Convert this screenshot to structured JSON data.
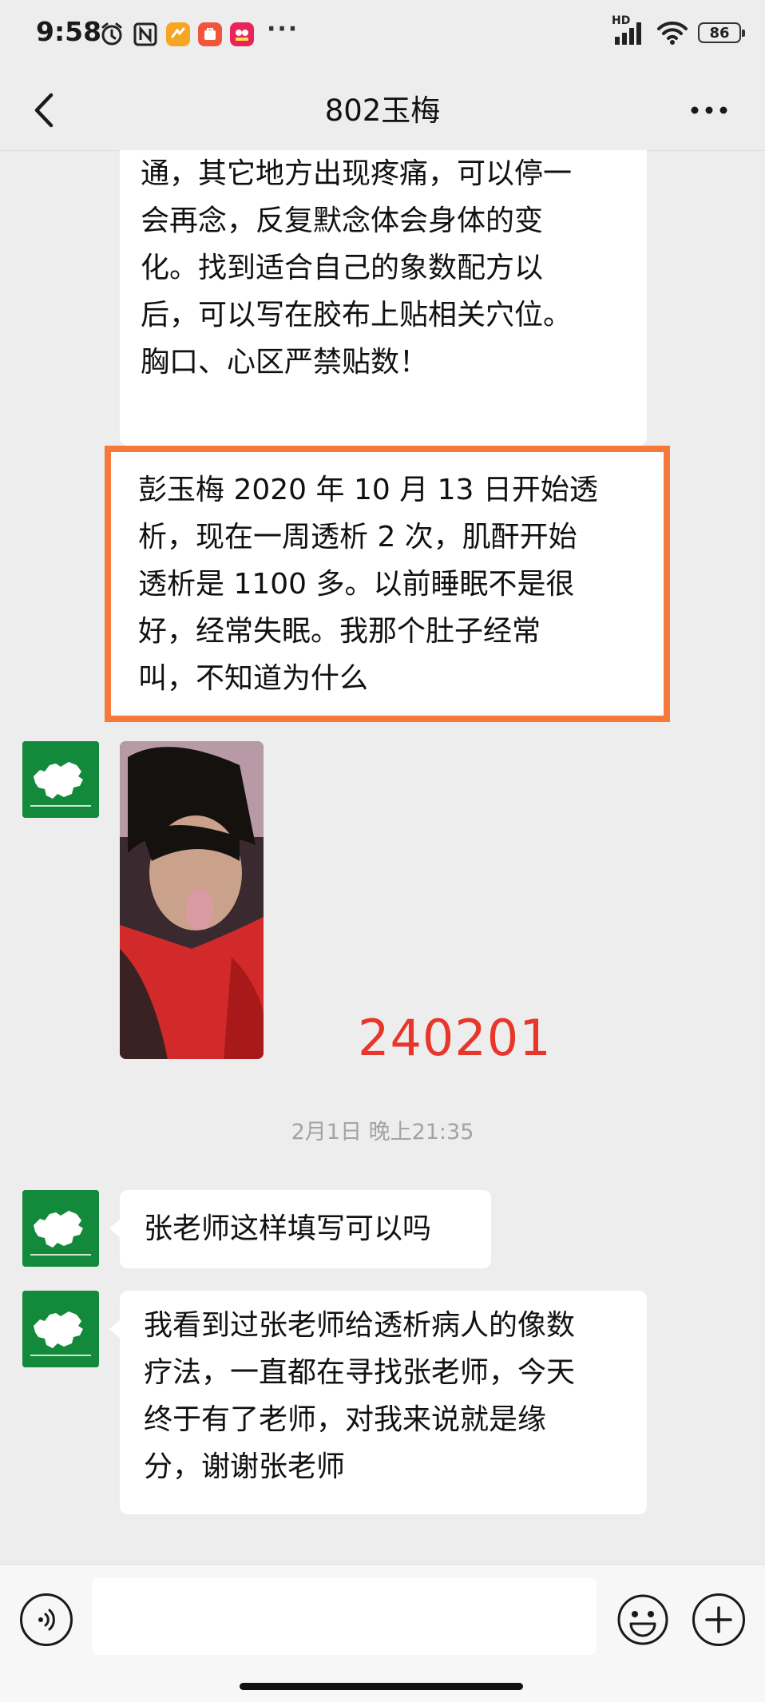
{
  "status": {
    "time": "9:58",
    "network_badge": "HD",
    "battery": "86"
  },
  "header": {
    "title": "802玉梅"
  },
  "messages": {
    "top_lines": [
      "通，其它地方出现疼痛，可以停一",
      "会再念，反复默念体会身体的变",
      "化。找到适合自己的象数配方以",
      "后，可以写在胶布上贴相关穴位。",
      "胸口、心区严禁贴数！"
    ],
    "highlight_lines": [
      "彭玉梅 2020 年 10 月 13 日开始透",
      "析，现在一周透析 2 次，肌酐开始",
      "透析是 1100 多。以前睡眠不是很",
      "好，经常失眠。我那个肚子经常",
      "叫，不知道为什么"
    ],
    "image_annotation": "240201",
    "timestamp": "2月1日 晚上21:35",
    "msg_question": "张老师这样填写可以吗",
    "last_lines": [
      "我看到过张老师给透析病人的像数",
      "疗法，一直都在寻找张老师，今天",
      "终于有了老师，对我来说就是缘",
      "分，谢谢张老师"
    ]
  },
  "input": {
    "value": "",
    "placeholder": ""
  },
  "colors": {
    "background": "#ededed",
    "bubble": "#ffffff",
    "highlight_border": "#f4793a",
    "annotation_red": "#e8362a",
    "avatar_green": "#138a3b"
  },
  "icons": [
    "alarm-icon",
    "nfc-icon",
    "app-icon-orange",
    "app-icon-red",
    "app-icon-pink",
    "signal-icon",
    "wifi-icon",
    "battery-icon",
    "back-arrow-icon",
    "more-icon",
    "voice-icon",
    "emoji-icon",
    "plus-icon"
  ]
}
